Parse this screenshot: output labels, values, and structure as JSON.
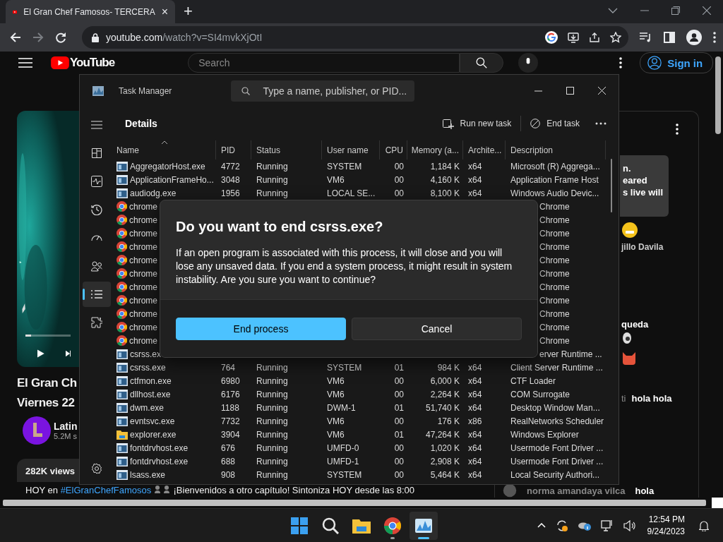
{
  "browser": {
    "tab_title": "El Gran Chef Famosos- TERCERA",
    "tab_close": "×",
    "new_tab": "+",
    "url_host": "youtube.com",
    "url_path": "/watch?v=SI4mvkXjOtI",
    "forward_disabled": true
  },
  "youtube": {
    "progress": {
      "level": 0.13
    },
    "logo": "YouTube",
    "search_placeholder": "Search",
    "sign_in": "Sign in",
    "title_lines": [
      "El Gran Ch",
      "Viernes 22"
    ],
    "channel": "Latin",
    "subscribers": "5.2M s",
    "views": "282K views",
    "description_prefix": "HOY en",
    "hashtag": "#ElGranChefFamosos",
    "description_text": "¡Bienvenidos a otro capítulo! Sintoniza HOY desde las 8:00"
  },
  "chat": {
    "notice_lines": [
      "n.",
      "eared",
      "s live will"
    ],
    "author_fragment": "jillo Davila",
    "message_fragment": "queda",
    "fragment_message": {
      "author": "ti",
      "text": "hola hola"
    },
    "last_message": {
      "author": "norma amandaya vilca",
      "text": "hola"
    }
  },
  "task_manager": {
    "title": "Task Manager",
    "search_placeholder": "Type a name, publisher, or PID...",
    "page_title": "Details",
    "run_new_task": "Run new task",
    "end_task": "End task",
    "nav": [
      {
        "kind": "menu",
        "selected": false
      },
      {
        "kind": "processes",
        "selected": false
      },
      {
        "kind": "performance",
        "selected": false
      },
      {
        "kind": "history",
        "selected": false
      },
      {
        "kind": "startup",
        "selected": false
      },
      {
        "kind": "users",
        "selected": false
      },
      {
        "kind": "details",
        "selected": true
      },
      {
        "kind": "services",
        "selected": false
      }
    ],
    "columns": [
      {
        "label": "Name",
        "sorted": true
      },
      {
        "label": "PID"
      },
      {
        "label": "Status"
      },
      {
        "label": "User name"
      },
      {
        "label": "CPU"
      },
      {
        "label": "Memory (a..."
      },
      {
        "label": "Archite..."
      },
      {
        "label": "Description"
      }
    ],
    "rows": [
      {
        "kind": "exe",
        "name": "AggregatorHost.exe",
        "pid": "4772",
        "status": "Running",
        "user": "SYSTEM",
        "cpu": "00",
        "memory": "1,184 K",
        "arch": "x64",
        "description": "Microsoft (R) Aggrega..."
      },
      {
        "kind": "exe",
        "name": "ApplicationFrameHo...",
        "pid": "3048",
        "status": "Running",
        "user": "VM6",
        "cpu": "00",
        "memory": "4,160 K",
        "arch": "x64",
        "description": "Application Frame Host"
      },
      {
        "kind": "exe",
        "name": "audiodg.exe",
        "pid": "1956",
        "status": "Running",
        "user": "LOCAL SE...",
        "cpu": "00",
        "memory": "8,100 K",
        "arch": "x64",
        "description": "Windows Audio Devic..."
      },
      {
        "kind": "chrome",
        "name": "chrome",
        "description": "Chrome"
      },
      {
        "kind": "chrome",
        "name": "chrome",
        "description": "Chrome"
      },
      {
        "kind": "chrome",
        "name": "chrome",
        "description": "Chrome"
      },
      {
        "kind": "chrome",
        "name": "chrome",
        "description": "Chrome"
      },
      {
        "kind": "chrome",
        "name": "chrome",
        "description": "Chrome"
      },
      {
        "kind": "chrome",
        "name": "chrome",
        "description": "Chrome"
      },
      {
        "kind": "chrome",
        "name": "chrome",
        "description": "Chrome"
      },
      {
        "kind": "chrome",
        "name": "chrome",
        "description": "Chrome"
      },
      {
        "kind": "chrome",
        "name": "chrome",
        "description": "Chrome"
      },
      {
        "kind": "chrome",
        "name": "chrome",
        "description": "Chrome"
      },
      {
        "kind": "chrome",
        "name": "chrome",
        "description": "Chrome"
      },
      {
        "kind": "exe",
        "name": "csrss.ex",
        "description": "erver Runtime ..."
      },
      {
        "kind": "exe",
        "name": "csrss.exe",
        "pid": "764",
        "status": "Running",
        "user": "SYSTEM",
        "cpu": "01",
        "memory": "984 K",
        "arch": "x64",
        "description": "Client Server Runtime ..."
      },
      {
        "kind": "exe",
        "name": "ctfmon.exe",
        "pid": "6980",
        "status": "Running",
        "user": "VM6",
        "cpu": "00",
        "memory": "6,000 K",
        "arch": "x64",
        "description": "CTF Loader"
      },
      {
        "kind": "exe",
        "name": "dllhost.exe",
        "pid": "6176",
        "status": "Running",
        "user": "VM6",
        "cpu": "00",
        "memory": "2,264 K",
        "arch": "x64",
        "description": "COM Surrogate"
      },
      {
        "kind": "exe",
        "name": "dwm.exe",
        "pid": "1188",
        "status": "Running",
        "user": "DWM-1",
        "cpu": "01",
        "memory": "51,740 K",
        "arch": "x64",
        "description": "Desktop Window Man..."
      },
      {
        "kind": "exe",
        "name": "evntsvc.exe",
        "pid": "7732",
        "status": "Running",
        "user": "VM6",
        "cpu": "00",
        "memory": "176 K",
        "arch": "x86",
        "description": "RealNetworks Scheduler"
      },
      {
        "kind": "folder",
        "name": "explorer.exe",
        "pid": "3904",
        "status": "Running",
        "user": "VM6",
        "cpu": "01",
        "memory": "47,264 K",
        "arch": "x64",
        "description": "Windows Explorer"
      },
      {
        "kind": "exe",
        "name": "fontdrvhost.exe",
        "pid": "676",
        "status": "Running",
        "user": "UMFD-0",
        "cpu": "00",
        "memory": "1,020 K",
        "arch": "x64",
        "description": "Usermode Font Driver ..."
      },
      {
        "kind": "exe",
        "name": "fontdrvhost.exe",
        "pid": "688",
        "status": "Running",
        "user": "UMFD-1",
        "cpu": "00",
        "memory": "2,908 K",
        "arch": "x64",
        "description": "Usermode Font Driver ..."
      },
      {
        "kind": "exe",
        "name": "lsass.exe",
        "pid": "908",
        "status": "Running",
        "user": "SYSTEM",
        "cpu": "00",
        "memory": "5,464 K",
        "arch": "x64",
        "description": "Local Security Authori..."
      }
    ],
    "dialog": {
      "title": "Do you want to end csrss.exe?",
      "body": "If an open program is associated with this process, it will close and you will lose any unsaved data. If you end a system process, it might result in system instability. Are you sure you want to continue?",
      "confirm": "End process",
      "cancel": "Cancel"
    }
  },
  "taskbar": {
    "apps": [
      {
        "kind": "start",
        "selected": false,
        "running": false
      },
      {
        "kind": "search",
        "selected": false,
        "running": false
      },
      {
        "kind": "explorer",
        "selected": false,
        "running": false
      },
      {
        "kind": "chrome",
        "selected": false,
        "running": true
      },
      {
        "kind": "taskmgr",
        "selected": true,
        "running": true
      }
    ],
    "time": "12:54 PM",
    "date": "9/24/2023"
  }
}
